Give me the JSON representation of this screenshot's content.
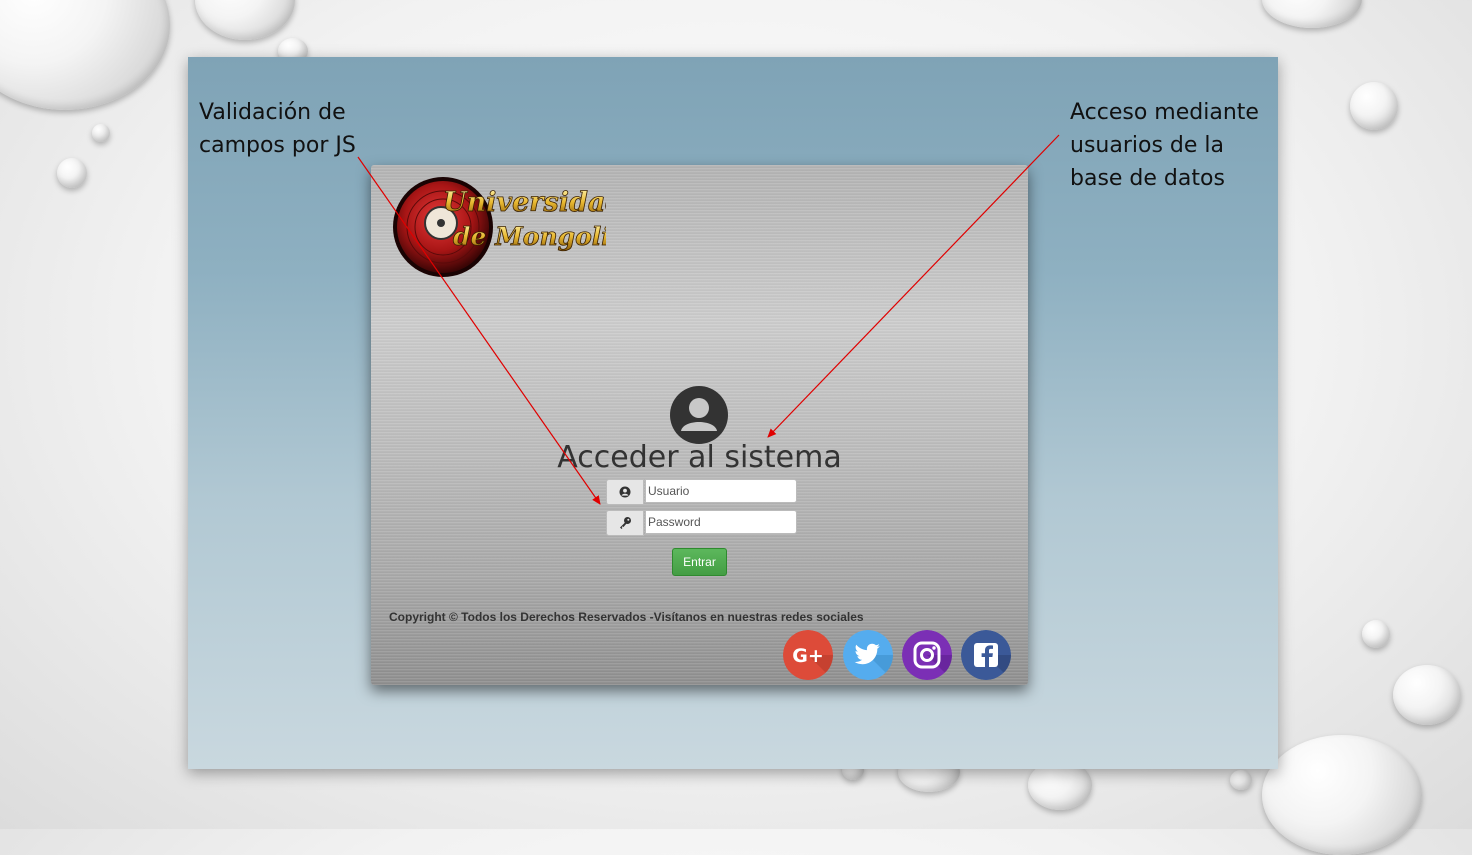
{
  "annotations": {
    "left": [
      "Validación de",
      "campos por JS"
    ],
    "right": [
      "Acceso mediante",
      "usuarios de la",
      "base de datos"
    ]
  },
  "login": {
    "logo_text": [
      "Universidad",
      "de Mongolia"
    ],
    "title": "Acceder al sistema",
    "username_placeholder": "Usuario",
    "password_placeholder": "Password",
    "submit_label": "Entrar",
    "copyright": "Copyright © Todos los Derechos Reservados -Visítanos en nuestras redes sociales"
  },
  "social": [
    {
      "name": "google-plus",
      "label": "G+",
      "color": "#dd4b39"
    },
    {
      "name": "twitter",
      "color": "#55acee"
    },
    {
      "name": "instagram",
      "color": "#7b2fb5"
    },
    {
      "name": "facebook",
      "color": "#3b5998"
    }
  ],
  "colors": {
    "slide_top": "#7fa3b6",
    "slide_bottom": "#c9d8df",
    "button": "#5cb85c",
    "arrow": "#e00000"
  }
}
